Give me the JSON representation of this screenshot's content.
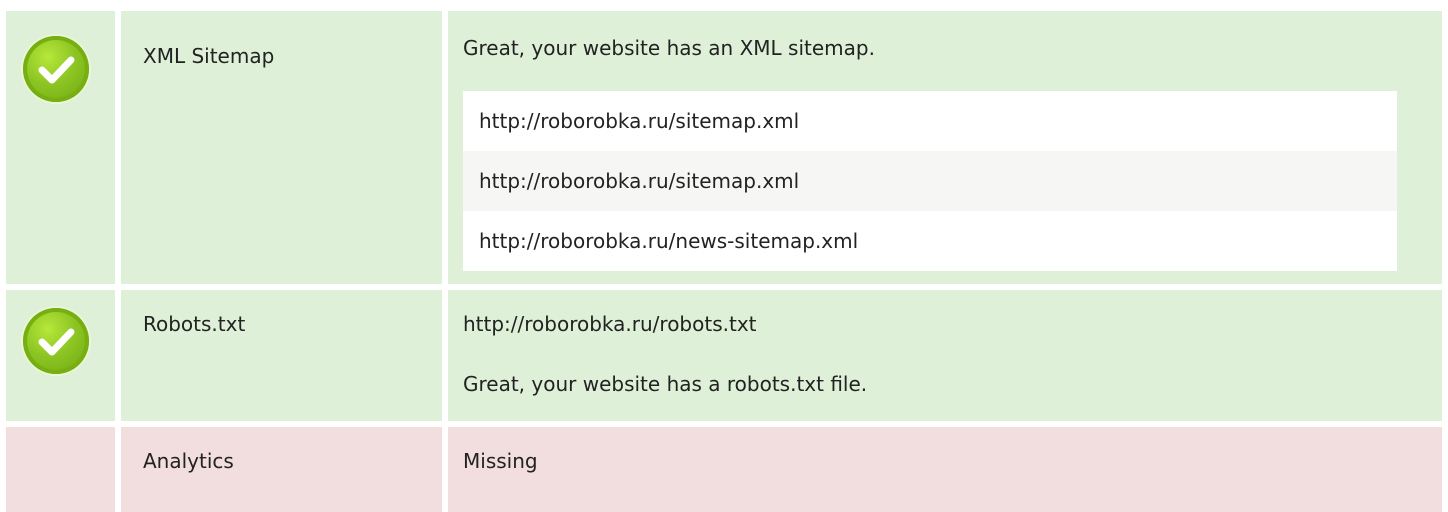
{
  "rows": [
    {
      "label": "XML Sitemap",
      "message": "Great, your website has an XML sitemap.",
      "urls": [
        "http://roborobka.ru/sitemap.xml",
        "http://roborobka.ru/sitemap.xml",
        "http://roborobka.ru/news-sitemap.xml"
      ],
      "status": "success",
      "status_icon": "check-circle-icon"
    },
    {
      "label": "Robots.txt",
      "url": "http://roborobka.ru/robots.txt",
      "message": "Great, your website has a robots.txt file.",
      "status": "success",
      "status_icon": "check-circle-icon"
    },
    {
      "label": "Analytics",
      "message": "Missing",
      "status": "error"
    }
  ],
  "colors": {
    "success_bg": "#dff0d8",
    "error_bg": "#f2dede",
    "check_green": "#8cc523"
  }
}
